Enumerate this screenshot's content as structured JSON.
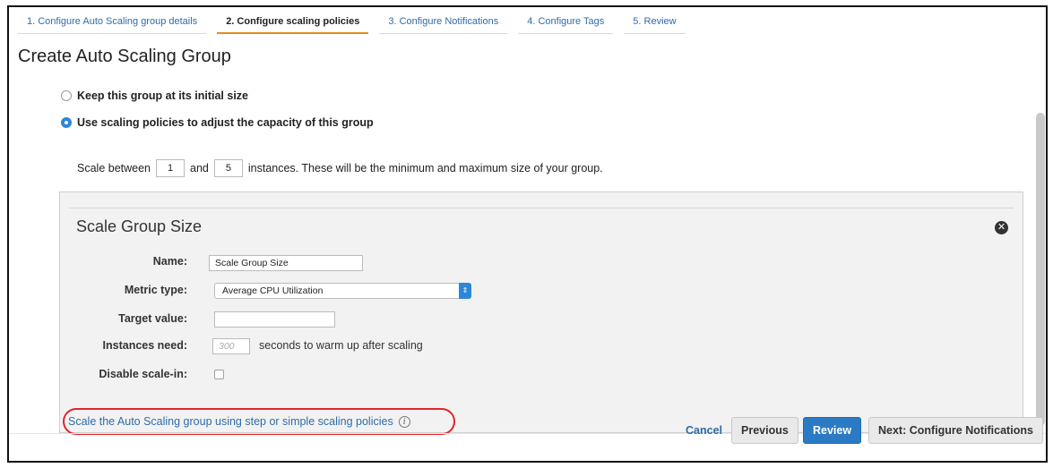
{
  "tabs": [
    {
      "label": "1. Configure Auto Scaling group details",
      "active": false
    },
    {
      "label": "2. Configure scaling policies",
      "active": true
    },
    {
      "label": "3. Configure Notifications",
      "active": false
    },
    {
      "label": "4. Configure Tags",
      "active": false
    },
    {
      "label": "5. Review",
      "active": false
    }
  ],
  "page_title": "Create Auto Scaling Group",
  "options": {
    "keep_size": "Keep this group at its initial size",
    "use_policies": "Use scaling policies to adjust the capacity of this group"
  },
  "scale_between": {
    "prefix": "Scale between",
    "min": "1",
    "and": "and",
    "max": "5",
    "suffix": "instances. These will be the minimum and maximum size of your group."
  },
  "panel": {
    "title": "Scale Group Size",
    "close_glyph": "✕",
    "name_label": "Name:",
    "name_value": "Scale Group Size",
    "metric_label": "Metric type:",
    "metric_value": "Average CPU Utilization",
    "select_arrow": "⇕",
    "target_label": "Target value:",
    "target_value": "",
    "instances_label": "Instances need:",
    "instances_placeholder": "300",
    "instances_suffix": "seconds to warm up after scaling",
    "disable_label": "Disable scale-in:",
    "disable_checked": false
  },
  "link": {
    "text": "Scale the Auto Scaling group using step or simple scaling policies",
    "info_glyph": "i"
  },
  "buttons": {
    "cancel": "Cancel",
    "previous": "Previous",
    "review": "Review",
    "next": "Next: Configure Notifications"
  },
  "colors": {
    "link": "#2f6ca8",
    "primary": "#2b7bc4",
    "active_tab_underline": "#e78a1e",
    "highlight": "#e0262b"
  }
}
